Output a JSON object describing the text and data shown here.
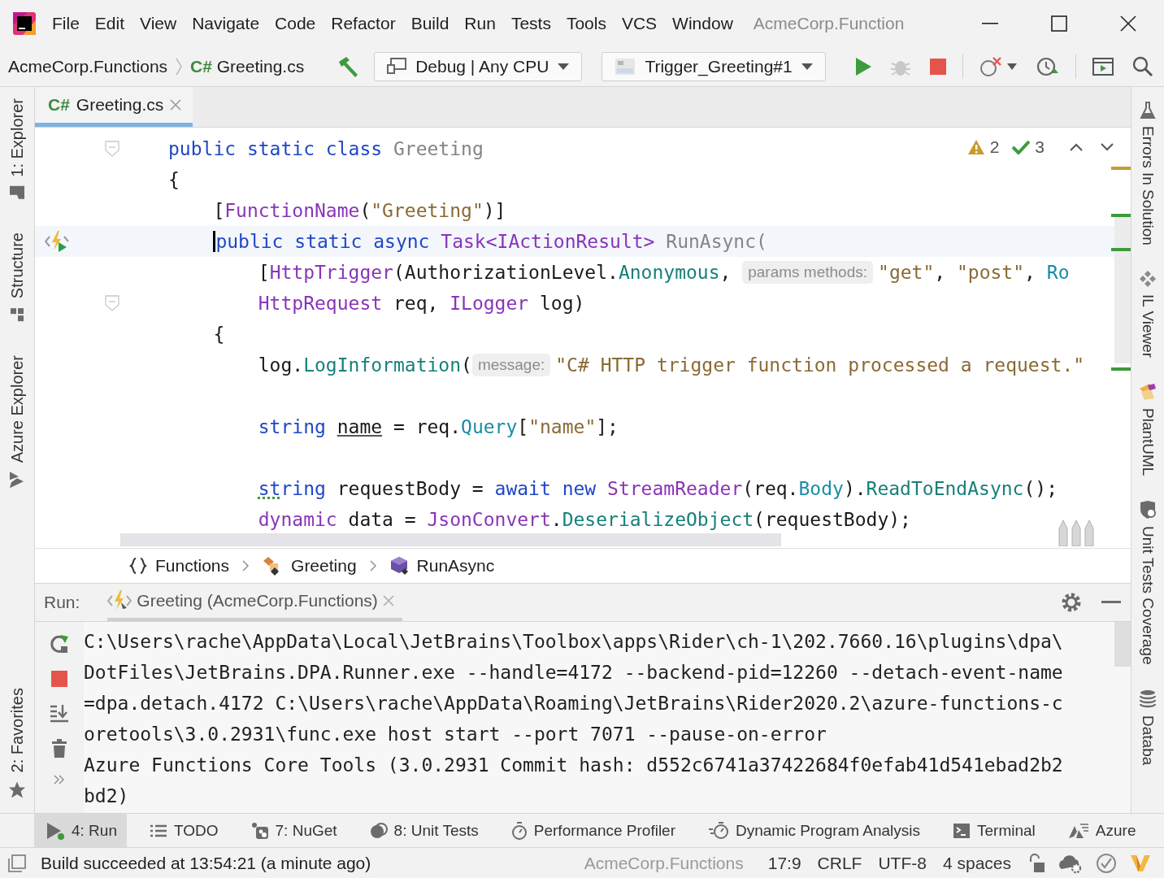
{
  "title_bar": {
    "menu": [
      "File",
      "Edit",
      "View",
      "Navigate",
      "Code",
      "Refactor",
      "Build",
      "Run",
      "Tests",
      "Tools",
      "VCS",
      "Window"
    ],
    "title": "AcmeCorp.Function"
  },
  "toolbar": {
    "project": "AcmeCorp.Functions",
    "file_badge": "C#",
    "file": "Greeting.cs",
    "configuration": "Debug | Any CPU",
    "run_target": "Trigger_Greeting#1",
    "debug_disabled": true
  },
  "left_tool_windows": [
    {
      "label": "1: Explorer",
      "kind": "folder"
    },
    {
      "label": "Structure",
      "kind": "structure"
    },
    {
      "label": "Azure Explorer",
      "kind": "azure"
    },
    {
      "label": "2: Favorites",
      "kind": "star"
    }
  ],
  "right_tool_windows": [
    {
      "label": "Errors In Solution",
      "kind": "flask"
    },
    {
      "label": "IL Viewer",
      "kind": "diamonds"
    },
    {
      "label": "PlantUML",
      "kind": "plantuml"
    },
    {
      "label": "Unit Tests Coverage",
      "kind": "shield"
    },
    {
      "label": "Databa",
      "kind": "database"
    }
  ],
  "editor": {
    "tabs": [
      {
        "badge": "C#",
        "label": "Greeting.cs",
        "selected": true
      }
    ],
    "inspections": {
      "warnings": "2",
      "passed": "3"
    },
    "stripe_marks": [
      {
        "color": "#c99a2e"
      },
      {
        "color": "#3d9a3d"
      },
      {
        "color": "#3d9a3d"
      },
      {
        "color": "#3d9a3d"
      }
    ],
    "lines": [
      {
        "fold": true,
        "parts": [
          {
            "kind": "code",
            "tokens": [
              {
                "text": "public static class ",
                "kind": "keyword"
              },
              {
                "text": "Greeting",
                "kind": "dim"
              }
            ]
          }
        ]
      },
      {
        "parts": [
          {
            "kind": "code",
            "tokens": [
              {
                "text": "{",
                "kind": "plain"
              }
            ]
          }
        ],
        "children": [
          {
            "parts": [
              {
                "kind": "code",
                "tokens": [
                  {
                    "text": "[",
                    "kind": "plain"
                  },
                  {
                    "text": "FunctionName",
                    "kind": "type"
                  },
                  {
                    "text": "(",
                    "kind": "plain"
                  },
                  {
                    "text": "\"Greeting\"",
                    "kind": "string"
                  },
                  {
                    "text": ")]",
                    "kind": "plain"
                  }
                ]
              }
            ]
          },
          {
            "current": true,
            "run_icon": true,
            "parts": [
              {
                "kind": "code",
                "tokens": [
                  {
                    "text": "public static async ",
                    "kind": "keyword",
                    "caret": true
                  },
                  {
                    "text": "Task<IActionResult>",
                    "kind": "type"
                  },
                  {
                    "text": " RunAsync(",
                    "kind": "dim"
                  }
                ]
              }
            ],
            "children": [
              {
                "parts": [
                  {
                    "kind": "code",
                    "tokens": [
                      {
                        "text": "[",
                        "kind": "plain"
                      },
                      {
                        "text": "HttpTrigger",
                        "kind": "type"
                      },
                      {
                        "text": "(AuthorizationLevel.",
                        "kind": "plain"
                      },
                      {
                        "text": "Anonymous",
                        "kind": "method"
                      },
                      {
                        "text": ", ",
                        "kind": "plain"
                      }
                    ]
                  },
                  {
                    "kind": "hint",
                    "text": "params methods:"
                  },
                  {
                    "kind": "code",
                    "tokens": [
                      {
                        "text": "\"get\"",
                        "kind": "string"
                      },
                      {
                        "text": ", ",
                        "kind": "plain"
                      },
                      {
                        "text": "\"post\"",
                        "kind": "string"
                      },
                      {
                        "text": ", ",
                        "kind": "plain"
                      },
                      {
                        "text": "Ro",
                        "kind": "property"
                      }
                    ]
                  }
                ]
              },
              {
                "fold": true,
                "parts": [
                  {
                    "kind": "code",
                    "tokens": [
                      {
                        "text": "HttpRequest",
                        "kind": "type"
                      },
                      {
                        "text": " req, ",
                        "kind": "plain"
                      },
                      {
                        "text": "ILogger",
                        "kind": "type"
                      },
                      {
                        "text": " log)",
                        "kind": "plain"
                      }
                    ]
                  }
                ]
              }
            ]
          },
          {
            "parts": [
              {
                "kind": "code",
                "tokens": [
                  {
                    "text": "{",
                    "kind": "plain"
                  }
                ]
              }
            ],
            "children": [
              {
                "parts": [
                  {
                    "kind": "code",
                    "tokens": [
                      {
                        "text": "log.",
                        "kind": "plain"
                      },
                      {
                        "text": "LogInformation",
                        "kind": "method"
                      },
                      {
                        "text": "(",
                        "kind": "plain"
                      }
                    ]
                  },
                  {
                    "kind": "hint",
                    "text": "message:"
                  },
                  {
                    "kind": "code",
                    "tokens": [
                      {
                        "text": "\"C# HTTP trigger function processed a request.\"",
                        "kind": "string"
                      }
                    ]
                  }
                ]
              },
              {
                "space_above": true,
                "parts": [
                  {
                    "kind": "code",
                    "tokens": [
                      {
                        "text": "string ",
                        "kind": "keyword"
                      },
                      {
                        "text": "name",
                        "kind": "underlined"
                      },
                      {
                        "text": " = req.",
                        "kind": "plain"
                      },
                      {
                        "text": "Query",
                        "kind": "property"
                      },
                      {
                        "text": "[",
                        "kind": "plain"
                      },
                      {
                        "text": "\"name\"",
                        "kind": "string"
                      },
                      {
                        "text": "];",
                        "kind": "plain"
                      }
                    ]
                  }
                ]
              },
              {
                "space_above": true,
                "parts": [
                  {
                    "kind": "code",
                    "tokens": [
                      {
                        "text": "st",
                        "kind": "weak"
                      },
                      {
                        "text": "ring",
                        "kind": "keyword"
                      },
                      {
                        "text": " requestBody = ",
                        "kind": "plain"
                      },
                      {
                        "text": "await new ",
                        "kind": "keyword"
                      },
                      {
                        "text": "StreamReader",
                        "kind": "type"
                      },
                      {
                        "text": "(req.",
                        "kind": "plain"
                      },
                      {
                        "text": "Body",
                        "kind": "property"
                      },
                      {
                        "text": ").",
                        "kind": "plain"
                      },
                      {
                        "text": "ReadToEndAsync",
                        "kind": "method"
                      },
                      {
                        "text": "();",
                        "kind": "plain"
                      }
                    ]
                  }
                ]
              },
              {
                "parts": [
                  {
                    "kind": "code",
                    "tokens": [
                      {
                        "text": "dynamic",
                        "kind": "type"
                      },
                      {
                        "text": " data = ",
                        "kind": "plain"
                      },
                      {
                        "text": "JsonConvert",
                        "kind": "type"
                      },
                      {
                        "text": ".",
                        "kind": "plain"
                      },
                      {
                        "text": "DeserializeObject",
                        "kind": "method"
                      },
                      {
                        "text": "(requestBody);",
                        "kind": "plain"
                      }
                    ]
                  }
                ]
              }
            ]
          }
        ]
      }
    ]
  },
  "breadcrumbs": [
    {
      "label": "Functions",
      "kind": "namespace"
    },
    {
      "label": "Greeting",
      "kind": "class"
    },
    {
      "label": "RunAsync",
      "kind": "method"
    }
  ],
  "run_panel": {
    "label": "Run:",
    "tabs": [
      {
        "label": "Greeting (AcmeCorp.Functions)",
        "selected": true
      }
    ],
    "output": [
      "C:\\Users\\rache\\AppData\\Local\\JetBrains\\Toolbox\\apps\\Rider\\ch-1\\202.7660.16\\plugins\\dpa\\",
      "DotFiles\\JetBrains.DPA.Runner.exe --handle=4172 --backend-pid=12260 --detach-event-name",
      "=dpa.detach.4172 C:\\Users\\rache\\AppData\\Roaming\\JetBrains\\Rider2020.2\\azure-functions-c",
      "oretools\\3.0.2931\\func.exe host start --port 7071 --pause-on-error",
      "Azure Functions Core Tools (3.0.2931 Commit hash: d552c6741a37422684f0efab41d541ebad2b2",
      "bd2)"
    ]
  },
  "tool_tabs": [
    {
      "label": "4: Run",
      "kind": "run",
      "selected": true
    },
    {
      "label": "TODO",
      "kind": "list",
      "selected": false
    },
    {
      "label": "7: NuGet",
      "kind": "nuget",
      "selected": false
    },
    {
      "label": "8: Unit Tests",
      "kind": "tests",
      "selected": false
    },
    {
      "label": "Performance Profiler",
      "kind": "timer",
      "selected": false
    },
    {
      "label": "Dynamic Program Analysis",
      "kind": "dpa",
      "selected": false
    },
    {
      "label": "Terminal",
      "kind": "terminal",
      "selected": false
    },
    {
      "label": "Azure",
      "kind": "azure",
      "selected": false
    }
  ],
  "status_bar": {
    "message": "Build succeeded at 13:54:21 (a minute ago)",
    "project": "AcmeCorp.Functions",
    "position": "17:9",
    "line_ending": "CRLF",
    "encoding": "UTF-8",
    "indent": "4 spaces"
  }
}
